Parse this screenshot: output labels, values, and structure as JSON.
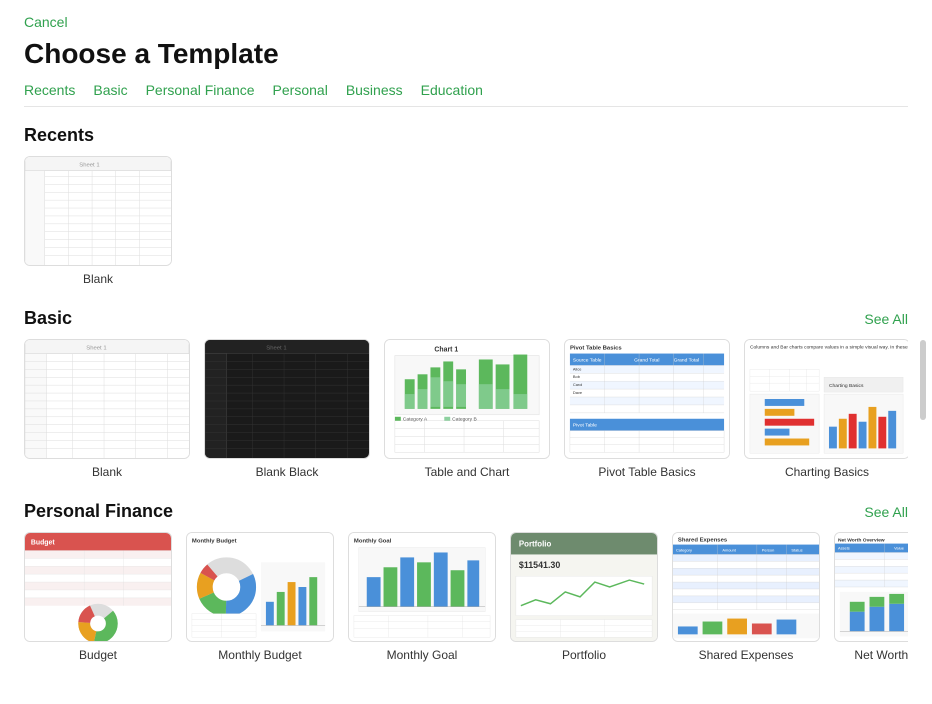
{
  "cancel_label": "Cancel",
  "page_title": "Choose a Template",
  "nav": {
    "items": [
      {
        "label": "Recents"
      },
      {
        "label": "Basic"
      },
      {
        "label": "Personal Finance"
      },
      {
        "label": "Personal"
      },
      {
        "label": "Business"
      },
      {
        "label": "Education"
      }
    ]
  },
  "recents": {
    "title": "Recents",
    "templates": [
      {
        "label": "Blank"
      }
    ]
  },
  "basic": {
    "title": "Basic",
    "see_all": "See All",
    "templates": [
      {
        "label": "Blank"
      },
      {
        "label": "Blank Black"
      },
      {
        "label": "Table and Chart"
      },
      {
        "label": "Pivot Table Basics"
      },
      {
        "label": "Charting Basics"
      }
    ]
  },
  "personal_finance": {
    "title": "Personal Finance",
    "see_all": "See All",
    "templates": [
      {
        "label": "Budget"
      },
      {
        "label": "Monthly Budget"
      },
      {
        "label": "Monthly Goal"
      },
      {
        "label": "Portfolio"
      },
      {
        "label": "Shared Expenses"
      },
      {
        "label": "Net Worth Overview"
      }
    ]
  }
}
